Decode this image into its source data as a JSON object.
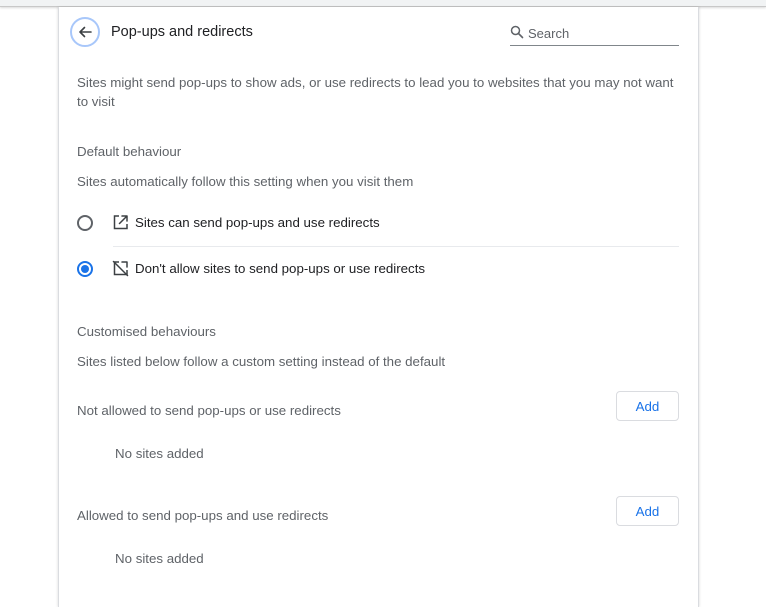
{
  "header": {
    "title": "Pop-ups and redirects",
    "back_icon": "arrow-left-icon",
    "search": {
      "icon": "search-icon",
      "placeholder": "Search",
      "value": ""
    }
  },
  "description": "Sites might send pop-ups to show ads, or use redirects to lead you to websites that you may not want to visit",
  "default_behaviour": {
    "title": "Default behaviour",
    "subtitle": "Sites automatically follow this setting when you visit them",
    "options": [
      {
        "label": "Sites can send pop-ups and use redirects",
        "icon": "open-in-new-icon",
        "selected": false
      },
      {
        "label": "Don't allow sites to send pop-ups or use redirects",
        "icon": "block-popup-icon",
        "selected": true
      }
    ]
  },
  "customised_behaviours": {
    "title": "Customised behaviours",
    "subtitle": "Sites listed below follow a custom setting instead of the default",
    "lists": [
      {
        "header": "Not allowed to send pop-ups or use redirects",
        "add_label": "Add",
        "empty_text": "No sites added"
      },
      {
        "header": "Allowed to send pop-ups and use redirects",
        "add_label": "Add",
        "empty_text": "No sites added"
      }
    ]
  },
  "colors": {
    "accent": "#1a73e8",
    "text_primary": "#202124",
    "text_secondary": "#5f6368"
  }
}
